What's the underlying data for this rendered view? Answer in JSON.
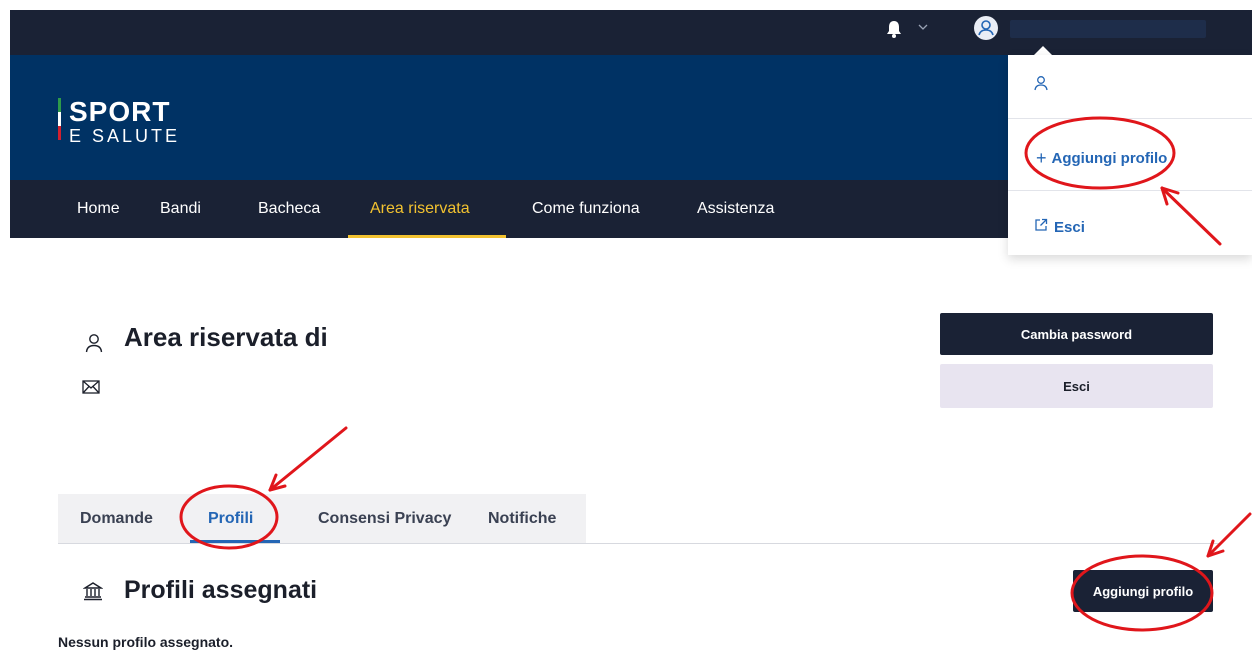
{
  "colors": {
    "topbar": "#1a2235",
    "header": "#003264",
    "nav_active": "#f2c230",
    "link_blue": "#2466b5",
    "annotation_red": "#e0161b"
  },
  "logo": {
    "line1": "SPORT",
    "line2": "E SALUTE"
  },
  "topbar": {
    "icons": [
      "bell-icon",
      "chevron-down-icon",
      "user-circle-icon"
    ]
  },
  "nav": {
    "items": [
      {
        "label": "Home"
      },
      {
        "label": "Bandi"
      },
      {
        "label": "Bacheca"
      },
      {
        "label": "Area riservata",
        "active": true
      },
      {
        "label": "Come funziona"
      },
      {
        "label": "Assistenza"
      }
    ]
  },
  "user_menu": {
    "add_profile": "Aggiungi profilo",
    "logout": "Esci"
  },
  "page": {
    "title": "Area riservata di",
    "change_password": "Cambia password",
    "logout": "Esci"
  },
  "tabs": [
    {
      "label": "Domande"
    },
    {
      "label": "Profili",
      "active": true
    },
    {
      "label": "Consensi Privacy"
    },
    {
      "label": "Notifiche"
    }
  ],
  "profiles": {
    "title": "Profili assegnati",
    "add_button": "Aggiungi profilo",
    "empty_message": "Nessun profilo assegnato."
  }
}
